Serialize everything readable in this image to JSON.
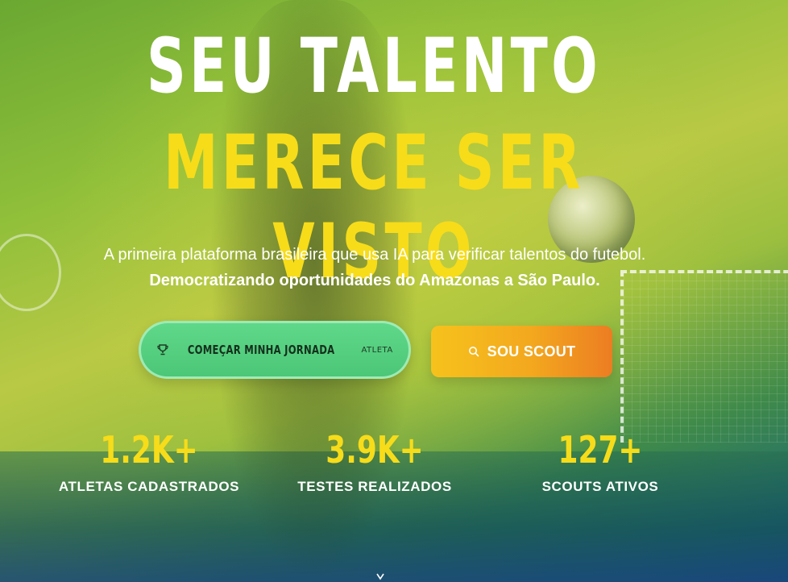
{
  "hero": {
    "title_line1": "SEU TALENTO",
    "title_line2": "MERECE SER VISTO",
    "subtitle_line1": "A primeira plataforma brasileira que usa IA para verificar talentos do futebol.",
    "subtitle_line2": "Democratizando oportunidades do Amazonas a São Paulo."
  },
  "buttons": {
    "athlete": {
      "label": "COMEÇAR MINHA JORNADA",
      "tag": "ATLETA",
      "icon": "trophy-icon"
    },
    "scout": {
      "label": "SOU SCOUT",
      "icon": "search-icon"
    }
  },
  "stats": [
    {
      "value": "1.2K+",
      "label": "ATLETAS CADASTRADOS"
    },
    {
      "value": "3.9K+",
      "label": "TESTES REALIZADOS"
    },
    {
      "value": "127+",
      "label": "SCOUTS ATIVOS"
    }
  ],
  "colors": {
    "accent_yellow": "#f7dc1a",
    "athlete_button": "#5fd88a",
    "scout_gradient_start": "#f6c21c",
    "scout_gradient_end": "#ec7d22",
    "text_white": "#ffffff"
  },
  "scroll_icon": "chevron-down-icon"
}
